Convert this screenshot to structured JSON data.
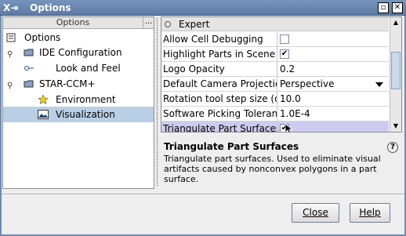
{
  "window": {
    "title": "Options",
    "app_icon": "java-cup-icon",
    "controls": [
      "minimize",
      "maximize",
      "close"
    ]
  },
  "tree": {
    "header": "Options",
    "header_more": "...",
    "items": [
      {
        "label": "Options",
        "icon": "options-icon"
      },
      {
        "label": "IDE Configuration",
        "icon": "folder-icon"
      },
      {
        "label": "Look and Feel",
        "icon": "key-icon"
      },
      {
        "label": "STAR-CCM+",
        "icon": "folder-icon"
      },
      {
        "label": "Environment",
        "icon": "star-icon"
      },
      {
        "label": "Visualization",
        "icon": "image-icon"
      }
    ],
    "selected": "Visualization"
  },
  "properties": {
    "section": "Expert",
    "rows": [
      {
        "name": "Allow Cell Debugging",
        "type": "checkbox",
        "checked": false
      },
      {
        "name": "Highlight Parts in Scene",
        "type": "checkbox",
        "checked": true
      },
      {
        "name": "Logo Opacity",
        "type": "text",
        "value": "0.2"
      },
      {
        "name": "Default Camera Projection",
        "type": "dropdown",
        "value": "Perspective"
      },
      {
        "name": "Rotation tool step size (deg)",
        "type": "text",
        "value": "10.0"
      },
      {
        "name": "Software Picking Tolerance",
        "type": "text",
        "value": "1.0E-4"
      },
      {
        "name": "Triangulate Part Surfaces",
        "type": "checkbox",
        "checked": true
      }
    ],
    "selected": "Triangulate Part Surfaces"
  },
  "description": {
    "title": "Triangulate Part Surfaces",
    "body": "Triangulate part surfaces.  Used to eliminate visual artifacts caused by nonconvex polygons in a part surface."
  },
  "buttons": {
    "close": "Close",
    "help": "Help"
  },
  "colors": {
    "titlebar": "#6f8cb3",
    "selection_tree": "#b8cfe5",
    "selection_property": "#ccccf0"
  }
}
